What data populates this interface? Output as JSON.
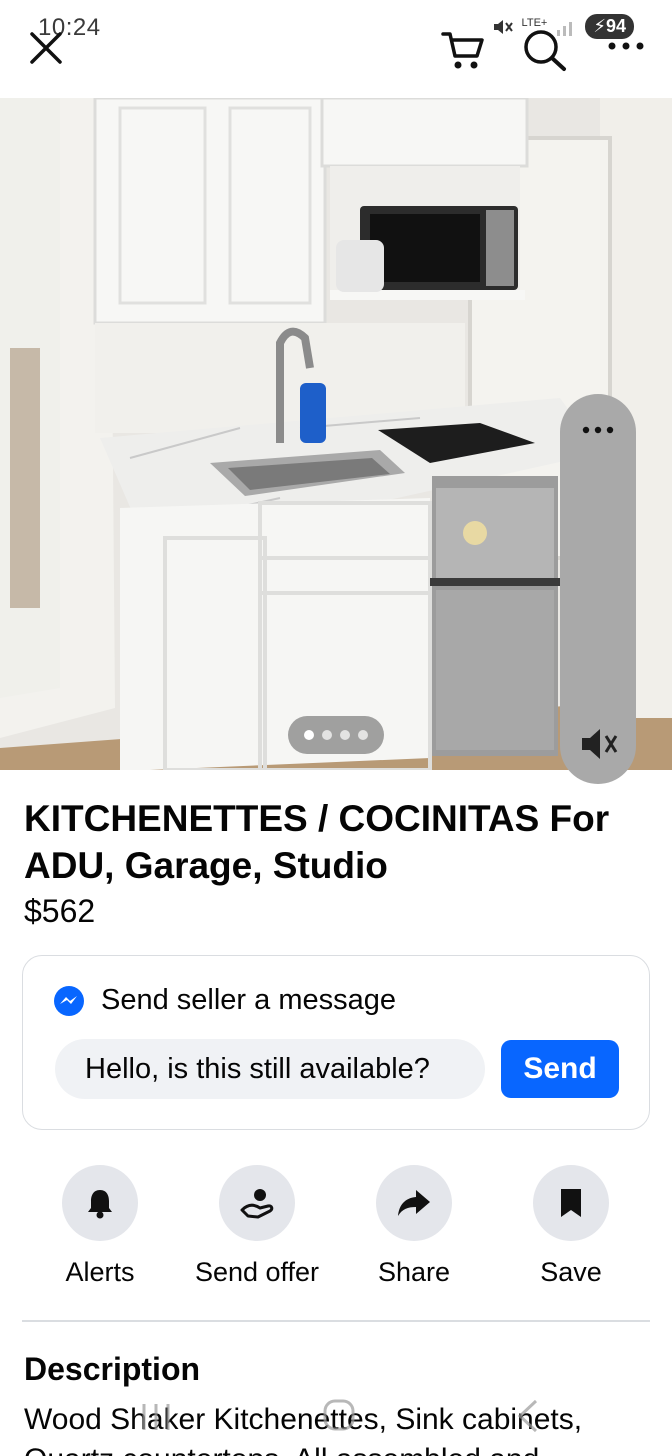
{
  "status_bar": {
    "time": "10:24",
    "network": "LTE+",
    "battery": "94"
  },
  "header": {
    "icons": [
      "close-icon",
      "cart-icon",
      "search-icon",
      "more-icon"
    ]
  },
  "photo": {
    "pager_count": 4,
    "pager_active_index": 0
  },
  "listing": {
    "title": "KITCHENETTES / COCINITAS For ADU, Garage, Studio",
    "price": "$562"
  },
  "message": {
    "heading": "Send seller a message",
    "input_value": "Hello, is this still available?",
    "send_label": "Send"
  },
  "actions": [
    {
      "label": "Alerts",
      "icon": "bell-icon"
    },
    {
      "label": "Send offer",
      "icon": "offer-hand-icon"
    },
    {
      "label": "Share",
      "icon": "share-arrow-icon"
    },
    {
      "label": "Save",
      "icon": "bookmark-icon"
    }
  ],
  "description": {
    "heading": "Description",
    "text": "Wood Shaker Kitchenettes, Sink cabinets, Quartz countertops. All assembled and"
  },
  "colors": {
    "accent": "#0866ff",
    "chip_bg": "#e4e6eb",
    "input_bg": "#f0f2f5",
    "border": "#dadde1"
  }
}
